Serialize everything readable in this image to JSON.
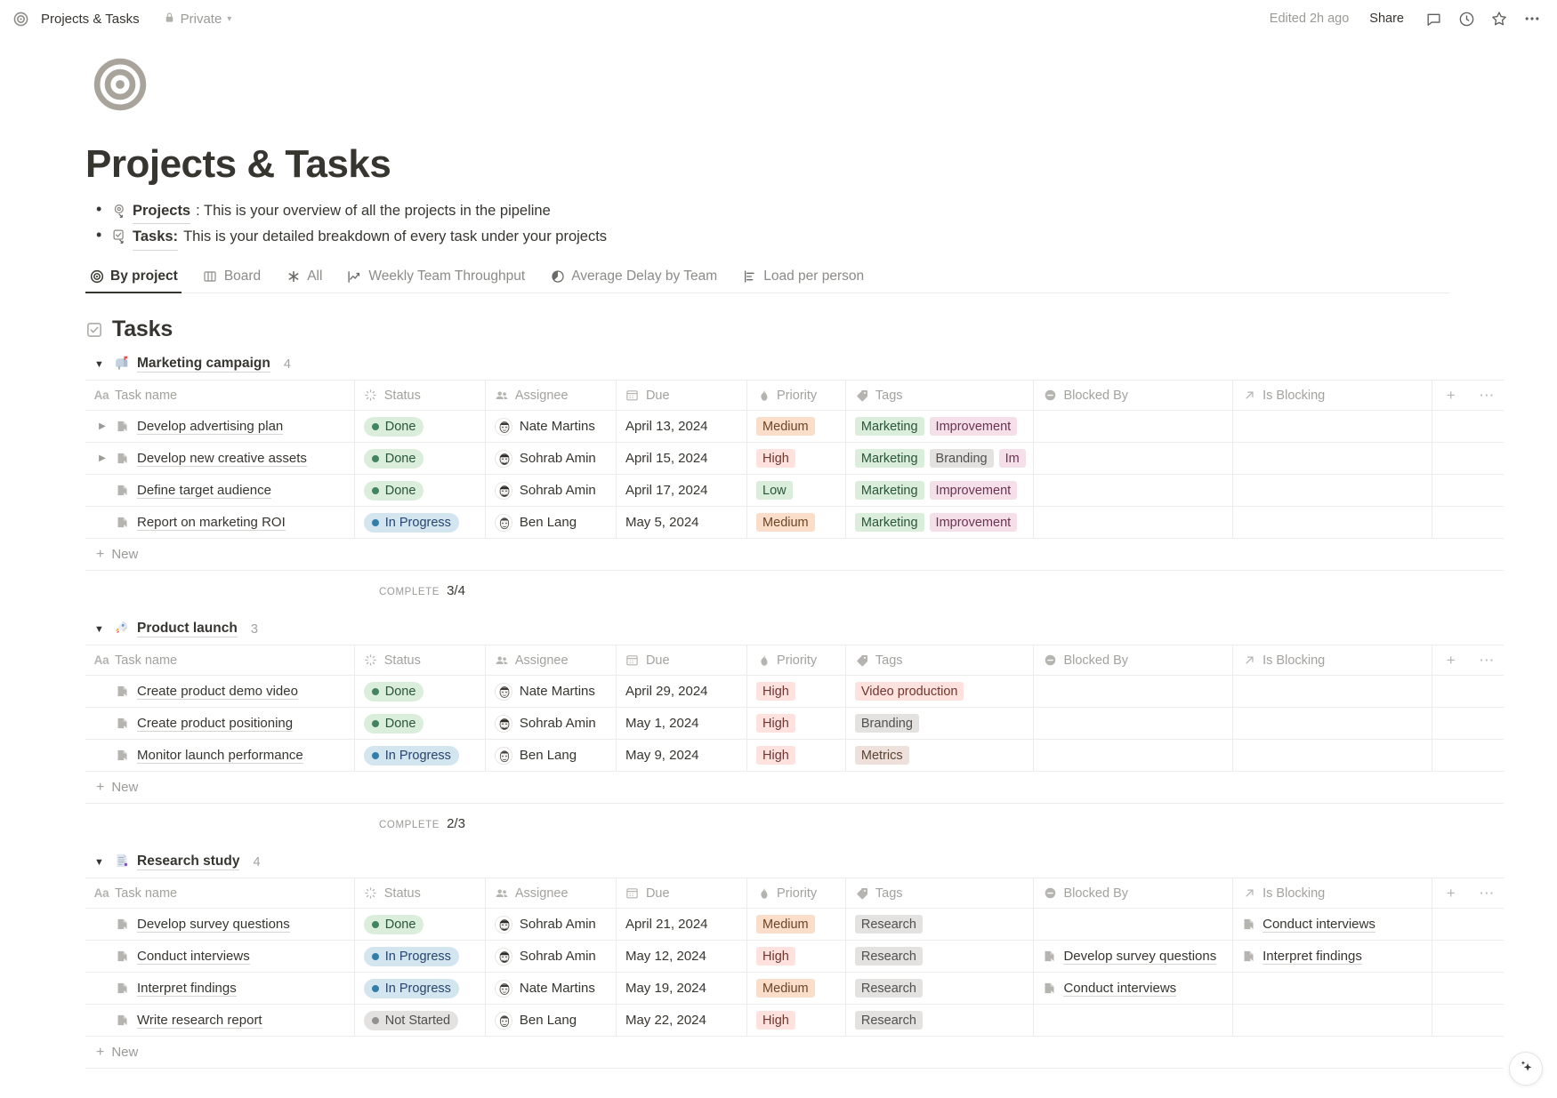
{
  "topbar": {
    "breadcrumb_icon": "target-icon",
    "breadcrumb_title": "Projects & Tasks",
    "privacy_label": "Private",
    "privacy_icon": "lock-icon",
    "edited_label": "Edited 2h ago",
    "share_label": "Share",
    "icons": [
      "comment-icon",
      "history-icon",
      "star-icon",
      "more-icon"
    ]
  },
  "page": {
    "emoji": "target-icon",
    "title": "Projects & Tasks",
    "bullets": [
      {
        "icon": "linked-page-icon",
        "link": "Projects",
        "rest": ": This is your overview of all the projects in the pipeline"
      },
      {
        "icon": "linked-task-icon",
        "link": "Tasks:",
        "rest": " This is your detailed breakdown of every task under your projects"
      }
    ]
  },
  "tabs": [
    {
      "label": "By project",
      "icon": "target-icon",
      "active": true
    },
    {
      "label": "Board",
      "icon": "board-icon",
      "active": false
    },
    {
      "label": "All",
      "icon": "asterisk-icon",
      "active": false
    },
    {
      "label": "Weekly Team Throughput",
      "icon": "line-chart-icon",
      "active": false
    },
    {
      "label": "Average Delay by Team",
      "icon": "pie-chart-icon",
      "active": false
    },
    {
      "label": "Load per person",
      "icon": "bar-chart-icon",
      "active": false
    }
  ],
  "database": {
    "heading": "Tasks",
    "heading_icon": "checkbox-icon",
    "columns": [
      {
        "label": "Task name",
        "icon": "title-icon"
      },
      {
        "label": "Status",
        "icon": "status-icon"
      },
      {
        "label": "Assignee",
        "icon": "person-icon"
      },
      {
        "label": "Due",
        "icon": "calendar-icon"
      },
      {
        "label": "Priority",
        "icon": "fire-icon"
      },
      {
        "label": "Tags",
        "icon": "tag-icon"
      },
      {
        "label": "Blocked By",
        "icon": "minus-circle-icon"
      },
      {
        "label": "Is Blocking",
        "icon": "arrow-up-right-icon"
      }
    ],
    "add_column_label": "+",
    "more_label": "…",
    "new_row_label": "New",
    "complete_label": "COMPLETE"
  },
  "groups": [
    {
      "name": "Marketing campaign",
      "emoji": "📫",
      "emoji_name": "mailbox-icon",
      "count": "4",
      "complete": "3/4",
      "rows": [
        {
          "expandable": true,
          "name": "Develop advertising plan",
          "status": "Done",
          "status_key": "done",
          "assignee": "Nate Martins",
          "avatar": "nate",
          "due": "April 13, 2024",
          "priority": "Medium",
          "priority_key": "medium",
          "tags": [
            {
              "label": "Marketing",
              "key": "marketing"
            },
            {
              "label": "Improvement",
              "key": "improvement"
            }
          ],
          "blocked_by": [],
          "is_blocking": []
        },
        {
          "expandable": true,
          "name": "Develop new creative assets",
          "status": "Done",
          "status_key": "done",
          "assignee": "Sohrab Amin",
          "avatar": "sohrab",
          "due": "April 15, 2024",
          "priority": "High",
          "priority_key": "high",
          "tags": [
            {
              "label": "Marketing",
              "key": "marketing"
            },
            {
              "label": "Branding",
              "key": "branding"
            },
            {
              "label": "Im",
              "key": "improvement"
            }
          ],
          "blocked_by": [],
          "is_blocking": []
        },
        {
          "expandable": false,
          "name": "Define target audience",
          "status": "Done",
          "status_key": "done",
          "assignee": "Sohrab Amin",
          "avatar": "sohrab",
          "due": "April 17, 2024",
          "priority": "Low",
          "priority_key": "low",
          "tags": [
            {
              "label": "Marketing",
              "key": "marketing"
            },
            {
              "label": "Improvement",
              "key": "improvement"
            }
          ],
          "blocked_by": [],
          "is_blocking": []
        },
        {
          "expandable": false,
          "name": "Report on marketing ROI",
          "status": "In Progress",
          "status_key": "progress",
          "assignee": "Ben Lang",
          "avatar": "ben",
          "due": "May 5, 2024",
          "priority": "Medium",
          "priority_key": "medium",
          "tags": [
            {
              "label": "Marketing",
              "key": "marketing"
            },
            {
              "label": "Improvement",
              "key": "improvement"
            }
          ],
          "blocked_by": [],
          "is_blocking": []
        }
      ]
    },
    {
      "name": "Product launch",
      "emoji": "🚀",
      "emoji_name": "rocket-icon",
      "count": "3",
      "complete": "2/3",
      "rows": [
        {
          "expandable": false,
          "name": "Create product demo video",
          "status": "Done",
          "status_key": "done",
          "assignee": "Nate Martins",
          "avatar": "nate",
          "due": "April 29, 2024",
          "priority": "High",
          "priority_key": "high",
          "tags": [
            {
              "label": "Video production",
              "key": "video"
            }
          ],
          "blocked_by": [],
          "is_blocking": []
        },
        {
          "expandable": false,
          "name": "Create product positioning",
          "status": "Done",
          "status_key": "done",
          "assignee": "Sohrab Amin",
          "avatar": "sohrab",
          "due": "May 1, 2024",
          "priority": "High",
          "priority_key": "high",
          "tags": [
            {
              "label": "Branding",
              "key": "branding"
            }
          ],
          "blocked_by": [],
          "is_blocking": []
        },
        {
          "expandable": false,
          "name": "Monitor launch performance",
          "status": "In Progress",
          "status_key": "progress",
          "assignee": "Ben Lang",
          "avatar": "ben",
          "due": "May 9, 2024",
          "priority": "High",
          "priority_key": "high",
          "tags": [
            {
              "label": "Metrics",
              "key": "metrics"
            }
          ],
          "blocked_by": [],
          "is_blocking": []
        }
      ]
    },
    {
      "name": "Research study",
      "emoji": "📑",
      "emoji_name": "document-icon",
      "count": "4",
      "complete": "",
      "rows": [
        {
          "expandable": false,
          "name": "Develop survey questions",
          "status": "Done",
          "status_key": "done",
          "assignee": "Sohrab Amin",
          "avatar": "sohrab",
          "due": "April 21, 2024",
          "priority": "Medium",
          "priority_key": "medium",
          "tags": [
            {
              "label": "Research",
              "key": "research"
            }
          ],
          "blocked_by": [],
          "is_blocking": [
            "Conduct interviews"
          ]
        },
        {
          "expandable": false,
          "name": "Conduct interviews",
          "status": "In Progress",
          "status_key": "progress",
          "assignee": "Sohrab Amin",
          "avatar": "sohrab",
          "due": "May 12, 2024",
          "priority": "High",
          "priority_key": "high",
          "tags": [
            {
              "label": "Research",
              "key": "research"
            }
          ],
          "blocked_by": [
            "Develop survey questions"
          ],
          "is_blocking": [
            "Interpret findings"
          ]
        },
        {
          "expandable": false,
          "name": "Interpret findings",
          "status": "In Progress",
          "status_key": "progress",
          "assignee": "Nate Martins",
          "avatar": "nate",
          "due": "May 19, 2024",
          "priority": "Medium",
          "priority_key": "medium",
          "tags": [
            {
              "label": "Research",
              "key": "research"
            }
          ],
          "blocked_by": [
            "Conduct interviews"
          ],
          "is_blocking": []
        },
        {
          "expandable": false,
          "name": "Write research report",
          "status": "Not Started",
          "status_key": "notstarted",
          "assignee": "Ben Lang",
          "avatar": "ben",
          "due": "May 22, 2024",
          "priority": "High",
          "priority_key": "high",
          "tags": [
            {
              "label": "Research",
              "key": "research"
            }
          ],
          "blocked_by": [],
          "is_blocking": []
        }
      ]
    }
  ],
  "ai_fab": {
    "icon": "sparkle-icon"
  },
  "colors": {
    "accent_text": "#37352f",
    "muted_text": "#9b9a97",
    "border": "#edecea",
    "green": "#dbeddb",
    "blue": "#d3e5ef",
    "gray": "#e3e2e0",
    "pink": "#f5e0e9",
    "red": "#ffe2dd",
    "orange": "#fadec9",
    "brown": "#eee0da"
  }
}
